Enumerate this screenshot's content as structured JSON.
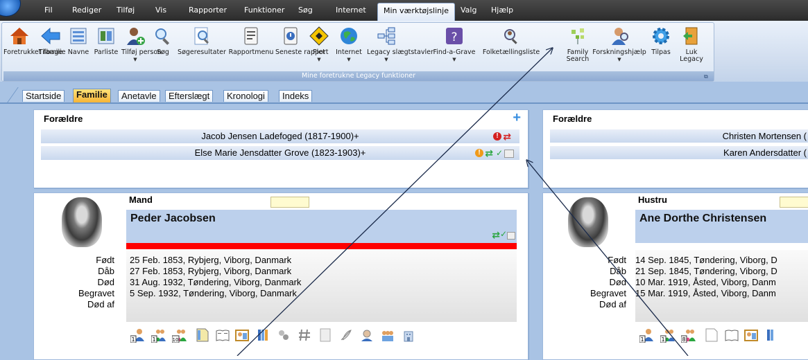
{
  "menu": {
    "items": [
      "Fil",
      "Rediger",
      "Tilføj",
      "Vis",
      "Rapporter",
      "Funktioner",
      "Søg",
      "Internet",
      "Min værktøjslinje",
      "Valg",
      "Hjælp"
    ],
    "active_index": 8
  },
  "ribbon": {
    "buttons": [
      {
        "label": "Foretrukket familie",
        "icon": "house-icon"
      },
      {
        "label": "Tilbage",
        "icon": "back-arrow-icon"
      },
      {
        "label": "Navne",
        "icon": "name-list-icon"
      },
      {
        "label": "Parliste",
        "icon": "couple-list-icon"
      },
      {
        "label": "Tilføj person",
        "icon": "add-person-icon",
        "dropdown": true
      },
      {
        "label": "Søg",
        "icon": "magnifier-icon"
      },
      {
        "label": "Søgeresultater",
        "icon": "search-results-icon"
      },
      {
        "label": "Rapportmenu",
        "icon": "report-menu-icon"
      },
      {
        "label": "Seneste rapport",
        "icon": "recent-report-icon"
      },
      {
        "label": "Flet",
        "icon": "merge-icon",
        "dropdown": true
      },
      {
        "label": "Internet",
        "icon": "globe-icon",
        "dropdown": true
      },
      {
        "label": "Legacy slægtstavler",
        "icon": "tree-chart-icon",
        "dropdown": true
      },
      {
        "label": "Find-a-Grave",
        "icon": "grave-icon",
        "dropdown": true
      },
      {
        "label": "Folketællingsliste",
        "icon": "census-icon"
      },
      {
        "label": "Family Search",
        "icon": "family-search-tree-icon"
      },
      {
        "label": "Forskningshjælp",
        "icon": "research-help-icon",
        "dropdown": true
      },
      {
        "label": "Tilpas",
        "icon": "gear-icon"
      },
      {
        "label": "Luk Legacy",
        "icon": "exit-door-icon"
      }
    ],
    "group_caption": "Mine foretrukne Legacy funktioner"
  },
  "tabs": [
    "Startside",
    "Familie",
    "Anetavle",
    "Efterslægt",
    "Kronologi",
    "Indeks"
  ],
  "active_tab": "Familie",
  "left": {
    "parents_title": "Forældre",
    "father": "Jacob Jensen Ladefoged (1817-1900)+",
    "mother": "Else Marie Jensdatter Grove (1823-1903)+",
    "role": "Mand",
    "name": "Peder Jacobsen",
    "events": [
      {
        "label": "Født",
        "value": "25 Feb. 1853, Rybjerg, Viborg, Danmark"
      },
      {
        "label": "Dåb",
        "value": "27 Feb. 1853, Rybjerg, Viborg, Danmark"
      },
      {
        "label": "Død",
        "value": "31 Aug. 1932, Tøndering, Viborg, Danmark"
      },
      {
        "label": "Begravet",
        "value": "5 Sep. 1932, Tøndering, Viborg, Danmark"
      },
      {
        "label": "Død af",
        "value": ""
      }
    ]
  },
  "right": {
    "parents_title": "Forældre",
    "father": "Christen Mortensen (",
    "mother": "Karen Andersdatter (",
    "role": "Hustru",
    "name": "Ane Dorthe Christensen",
    "events": [
      {
        "label": "Født",
        "value": "14 Sep. 1845, Tøndering, Viborg, D"
      },
      {
        "label": "Dåb",
        "value": "21 Sep. 1845, Tøndering, Viborg, D"
      },
      {
        "label": "Død",
        "value": "10 Mar. 1919, Åsted, Viborg, Danm"
      },
      {
        "label": "Begravet",
        "value": "15 Mar. 1919, Åsted, Viborg, Danm"
      },
      {
        "label": "Død af",
        "value": ""
      }
    ]
  },
  "badges": {
    "one": "1",
    "ten": "10",
    "eight": "8",
    "plus": "+"
  },
  "colors": {
    "accent_red": "#ff0000",
    "name_bar": "#bcd0ec",
    "tab_active": "#f6b436",
    "background": "#a9c3e4"
  }
}
